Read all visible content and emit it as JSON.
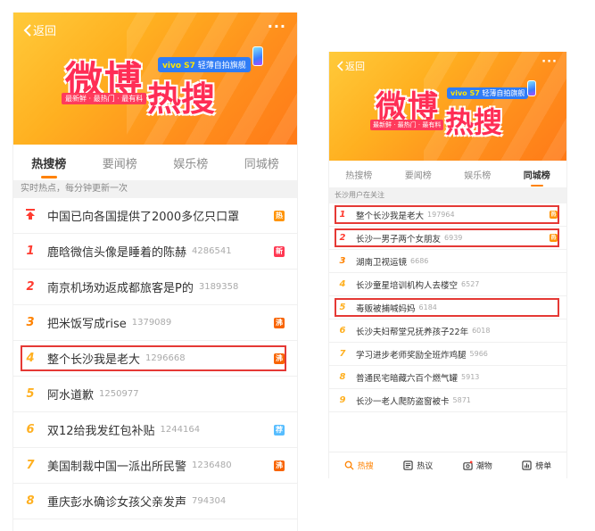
{
  "common": {
    "back_label": "返回",
    "more_label": "···",
    "brand_title": "微博",
    "brand_title2": "热搜",
    "promo_brand": "vivo S7",
    "promo_text": "轻薄自拍旗舰",
    "slogan": "最新鲜 · 最热门 · 最有料"
  },
  "left_screen": {
    "tabs": [
      {
        "label": "热搜榜",
        "active": true
      },
      {
        "label": "要闻榜",
        "active": false
      },
      {
        "label": "娱乐榜",
        "active": false
      },
      {
        "label": "同城榜",
        "active": false
      }
    ],
    "subheader": "实时热点，每分钟更新一次",
    "items": [
      {
        "rank": "↑",
        "topic": "中国已向各国提供了2000多亿只口罩",
        "count": "",
        "badge": "热",
        "highlighted": false
      },
      {
        "rank": "1",
        "topic": "鹿晗微信头像是睡着的陈赫",
        "count": "4286541",
        "badge": "新",
        "highlighted": false
      },
      {
        "rank": "2",
        "topic": "南京机场劝返成都旅客是P的",
        "count": "3189358",
        "badge": "",
        "highlighted": false
      },
      {
        "rank": "3",
        "topic": "把米饭写成rise",
        "count": "1379089",
        "badge": "沸",
        "highlighted": false
      },
      {
        "rank": "4",
        "topic": "整个长沙我是老大",
        "count": "1296668",
        "badge": "沸",
        "highlighted": true
      },
      {
        "rank": "5",
        "topic": "阿水道歉",
        "count": "1250977",
        "badge": "",
        "highlighted": false
      },
      {
        "rank": "6",
        "topic": "双12给我发红包补贴",
        "count": "1244164",
        "badge": "荐",
        "highlighted": false
      },
      {
        "rank": "7",
        "topic": "美国制裁中国一派出所民警",
        "count": "1236480",
        "badge": "沸",
        "highlighted": false
      },
      {
        "rank": "8",
        "topic": "重庆彭水确诊女孩父亲发声",
        "count": "794304",
        "badge": "",
        "highlighted": false
      }
    ]
  },
  "right_screen": {
    "tabs": [
      {
        "label": "热搜榜",
        "active": false
      },
      {
        "label": "要闻榜",
        "active": false
      },
      {
        "label": "娱乐榜",
        "active": false
      },
      {
        "label": "同城榜",
        "active": true
      }
    ],
    "subheader": "长沙用户在关注",
    "items": [
      {
        "rank": "1",
        "topic": "整个长沙我是老大",
        "count": "197964",
        "badge": "热",
        "highlighted": true
      },
      {
        "rank": "2",
        "topic": "长沙一男子两个女朋友",
        "count": "6939",
        "badge": "热",
        "highlighted": true
      },
      {
        "rank": "3",
        "topic": "湖南卫视运镜",
        "count": "6686",
        "badge": "",
        "highlighted": false
      },
      {
        "rank": "4",
        "topic": "长沙童星培训机构人去楼空",
        "count": "6527",
        "badge": "",
        "highlighted": false
      },
      {
        "rank": "5",
        "topic": "毒贩被捕喊妈妈",
        "count": "6184",
        "badge": "",
        "highlighted": true
      },
      {
        "rank": "6",
        "topic": "长沙夫妇帮堂兄抚养孩子22年",
        "count": "6018",
        "badge": "",
        "highlighted": false
      },
      {
        "rank": "7",
        "topic": "学习进步老师奖励全班炸鸡腿",
        "count": "5966",
        "badge": "",
        "highlighted": false
      },
      {
        "rank": "8",
        "topic": "普通民宅暗藏六百个燃气罐",
        "count": "5913",
        "badge": "",
        "highlighted": false
      },
      {
        "rank": "9",
        "topic": "长沙一老人爬防盗窗被卡",
        "count": "5871",
        "badge": "",
        "highlighted": false
      }
    ],
    "bottom_nav": [
      {
        "label": "热搜",
        "icon": "hot-search-icon",
        "active": true
      },
      {
        "label": "热议",
        "icon": "discussion-icon",
        "active": false
      },
      {
        "label": "潮物",
        "icon": "trend-goods-icon",
        "active": false
      },
      {
        "label": "榜单",
        "icon": "ranking-chart-icon",
        "active": false
      }
    ]
  },
  "colors": {
    "accent": "#ff8200",
    "highlight_box": "#e53935",
    "rank_top": "#ff3b30",
    "badge_hot": "#ff9406",
    "badge_new": "#ff3852",
    "badge_boiling": "#f86400",
    "badge_recommend": "#56bdff"
  }
}
